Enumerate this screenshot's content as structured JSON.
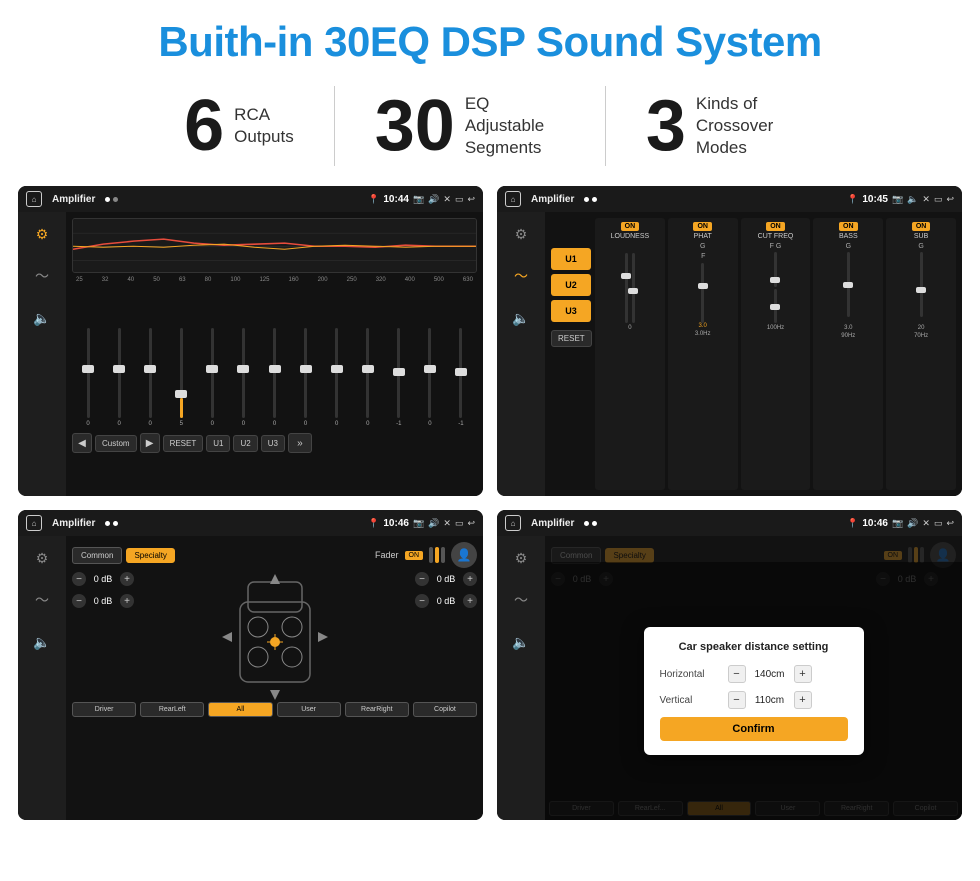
{
  "page": {
    "title": "Buith-in 30EQ DSP Sound System"
  },
  "stats": [
    {
      "number": "6",
      "label": "RCA\nOutputs"
    },
    {
      "number": "30",
      "label": "EQ Adjustable\nSegments"
    },
    {
      "number": "3",
      "label": "Kinds of\nCrossover Modes"
    }
  ],
  "screens": {
    "screen1": {
      "topbar": {
        "app": "Amplifier",
        "time": "10:44"
      },
      "freqs": [
        "25",
        "32",
        "40",
        "50",
        "63",
        "80",
        "100",
        "125",
        "160",
        "200",
        "250",
        "320",
        "400",
        "500",
        "630"
      ],
      "sliders": [
        0,
        0,
        0,
        5,
        0,
        0,
        0,
        0,
        0,
        0,
        -1,
        0,
        -1
      ],
      "preset": "Custom",
      "buttons": [
        "RESET",
        "U1",
        "U2",
        "U3"
      ]
    },
    "screen2": {
      "topbar": {
        "app": "Amplifier",
        "time": "10:45"
      },
      "channels": [
        "LOUDNESS",
        "PHAT",
        "CUT FREQ",
        "BASS",
        "SUB"
      ],
      "uButtons": [
        "U1",
        "U2",
        "U3"
      ],
      "resetBtn": "RESET"
    },
    "screen3": {
      "topbar": {
        "app": "Amplifier",
        "time": "10:46"
      },
      "tabs": [
        "Common",
        "Specialty"
      ],
      "faderLabel": "Fader",
      "onBadge": "ON",
      "dbValues": [
        "0 dB",
        "0 dB",
        "0 dB",
        "0 dB"
      ],
      "bottomBtns": [
        "Driver",
        "RearLeft",
        "All",
        "User",
        "RearRight",
        "Copilot"
      ]
    },
    "screen4": {
      "topbar": {
        "app": "Amplifier",
        "time": "10:46"
      },
      "tabs": [
        "Common",
        "Specialty"
      ],
      "dialog": {
        "title": "Car speaker distance setting",
        "horizontal": {
          "label": "Horizontal",
          "value": "140cm"
        },
        "vertical": {
          "label": "Vertical",
          "value": "110cm"
        },
        "confirmBtn": "Confirm"
      },
      "dbValues": [
        "0 dB",
        "0 dB"
      ],
      "bottomBtns": [
        "Driver",
        "RearLef...",
        "All",
        "User",
        "RearRight",
        "Copilot"
      ]
    }
  }
}
